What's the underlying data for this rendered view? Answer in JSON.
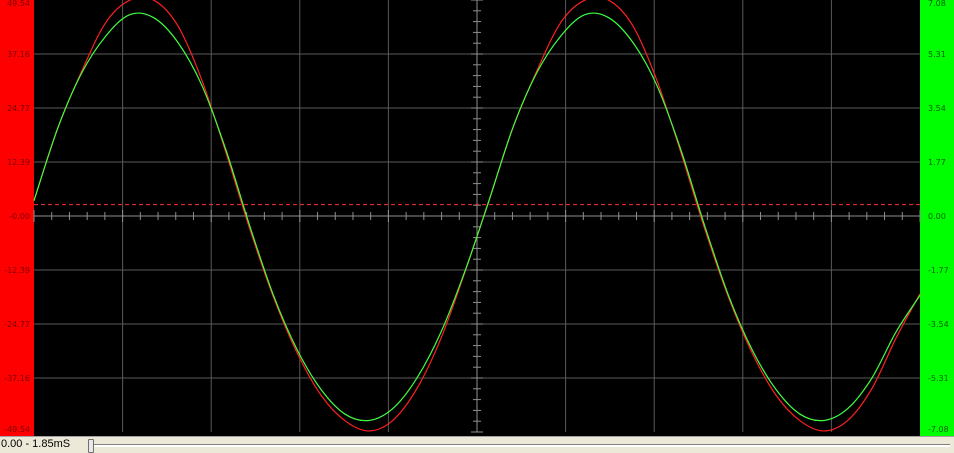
{
  "colors": {
    "background": "#000000",
    "left_axis_panel": "#ff0000",
    "right_axis_panel": "#00ff00",
    "grid": "#5a5a5a",
    "axis": "#909090",
    "trigger_line": "#ff3030"
  },
  "chart_data": {
    "type": "line",
    "title": "",
    "xlabel": "",
    "ylabel": "",
    "x_range_ms": [
      0.0,
      1.85
    ],
    "grid": true,
    "left_axis": {
      "ylim": [
        -49.54,
        49.54
      ],
      "ticks": [
        "49.54",
        "37.16",
        "24.77",
        "12.39",
        "-0.00",
        "-12.39",
        "-24.77",
        "-37.16",
        "-49.54"
      ]
    },
    "right_axis": {
      "ylim": [
        -7.08,
        7.08
      ],
      "ticks": [
        "7.08",
        "5.31",
        "3.54",
        "1.77",
        "0.00",
        "-1.77",
        "-3.54",
        "-5.31",
        "-7.08"
      ]
    },
    "trigger_level": 2.6,
    "series": [
      {
        "color": "#ff2020",
        "axis": "left",
        "x": [
          0.0,
          0.05,
          0.1,
          0.15,
          0.2,
          0.25,
          0.3,
          0.35,
          0.4,
          0.45,
          0.5,
          0.55,
          0.6,
          0.65,
          0.7,
          0.75,
          0.8,
          0.85,
          0.9,
          0.95,
          1.0,
          1.05,
          1.1,
          1.15,
          1.2,
          1.25,
          1.3,
          1.35,
          1.4,
          1.45,
          1.5,
          1.55,
          1.6,
          1.65,
          1.7,
          1.75,
          1.8,
          1.85
        ],
        "y": [
          3.6,
          20.2,
          33.3,
          44.4,
          49.5,
          49.5,
          43.7,
          31.3,
          14.8,
          -2.8,
          -18.6,
          -31.5,
          -41.2,
          -47.0,
          -49.3,
          -46.8,
          -39.5,
          -28.0,
          -12.8,
          3.6,
          20.2,
          33.3,
          44.4,
          49.5,
          49.5,
          43.7,
          31.3,
          14.8,
          -2.8,
          -18.6,
          -31.5,
          -41.2,
          -47.0,
          -49.3,
          -46.8,
          -39.5,
          -28.0,
          -17.8
        ]
      },
      {
        "color": "#40ff40",
        "axis": "right",
        "x": [
          0.0,
          0.05,
          0.1,
          0.15,
          0.2,
          0.25,
          0.3,
          0.35,
          0.4,
          0.45,
          0.5,
          0.55,
          0.6,
          0.65,
          0.7,
          0.75,
          0.8,
          0.85,
          0.9,
          0.95,
          1.0,
          1.05,
          1.1,
          1.15,
          1.2,
          1.25,
          1.3,
          1.35,
          1.4,
          1.45,
          1.5,
          1.55,
          1.6,
          1.65,
          1.7,
          1.75,
          1.8,
          1.85
        ],
        "y": [
          0.5,
          2.9,
          4.7,
          5.9,
          6.6,
          6.5,
          5.7,
          4.3,
          2.2,
          -0.3,
          -2.6,
          -4.4,
          -5.7,
          -6.5,
          -6.7,
          -6.3,
          -5.3,
          -3.8,
          -1.8,
          0.5,
          2.9,
          4.7,
          5.9,
          6.6,
          6.5,
          5.7,
          4.3,
          2.2,
          -0.3,
          -2.6,
          -4.4,
          -5.7,
          -6.5,
          -6.7,
          -6.3,
          -5.3,
          -3.8,
          -2.6
        ]
      }
    ]
  },
  "statusbar": {
    "range_text": "0.00 - 1.85mS",
    "slider_position": 0.0
  }
}
